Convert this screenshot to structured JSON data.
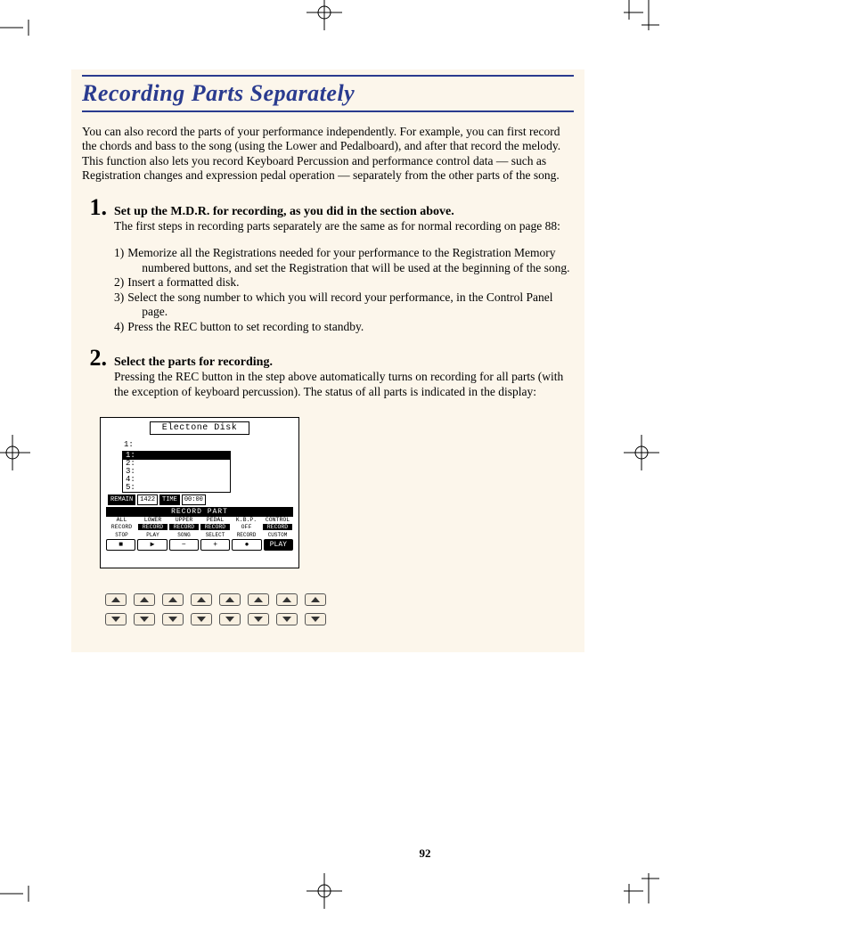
{
  "title": "Recording Parts Separately",
  "intro": "You can also record the parts of your performance independently.  For example, you can first record the chords and bass to the song (using the Lower and Pedalboard), and after that record the melody.  This function also lets you record Keyboard Percussion and performance control data — such as Registration changes and expression pedal operation — separately from the other parts of the song.",
  "step1": {
    "num": "1.",
    "head": "Set up the M.D.R. for recording, as you did in the section above.",
    "lead": "The first steps in recording parts separately are the same as for normal recording on page 88:",
    "items": [
      {
        "n": "1)",
        "t": "Memorize all the Registrations needed for your performance to the Registration Memory",
        "t2": "numbered buttons, and set the Registration that will be used at the beginning of the song."
      },
      {
        "n": "2)",
        "t": "Insert a formatted disk."
      },
      {
        "n": "3)",
        "t": "Select the song number to which you will record your performance, in the Control Panel",
        "t2": "page."
      },
      {
        "n": "4)",
        "t": "Press the REC button to set recording to standby."
      }
    ]
  },
  "step2": {
    "num": "2.",
    "head": "Select the parts for recording.",
    "body": "Pressing the REC button in the step above automatically turns on recording for all parts (with the exception of keyboard percussion).  The status of all parts is indicated in the display:"
  },
  "lcd": {
    "title": "Electone Disk",
    "selected": "1:",
    "rows": [
      "1:",
      "2:",
      "3:",
      "4:",
      "5:"
    ],
    "remain_label": "REMAIN",
    "remain_val": "1422",
    "time_label": "TIME",
    "time_val": "00:00",
    "band": "RECORD PART",
    "parts_top": [
      "ALL",
      "LOWER",
      "UPPER",
      "PEDAL",
      "K.B.P.",
      "CONTROL"
    ],
    "parts_state": [
      "RECORD",
      "RECORD",
      "RECORD",
      "RECORD",
      "OFF",
      "RECORD"
    ],
    "ctrl_labels": [
      "STOP",
      "PLAY",
      "SONG",
      "SELECT",
      "RECORD",
      "CUSTOM"
    ],
    "ctrl_btns": [
      "■",
      "▶",
      "−",
      "+",
      "●",
      "PLAY"
    ]
  },
  "page_number": "92"
}
